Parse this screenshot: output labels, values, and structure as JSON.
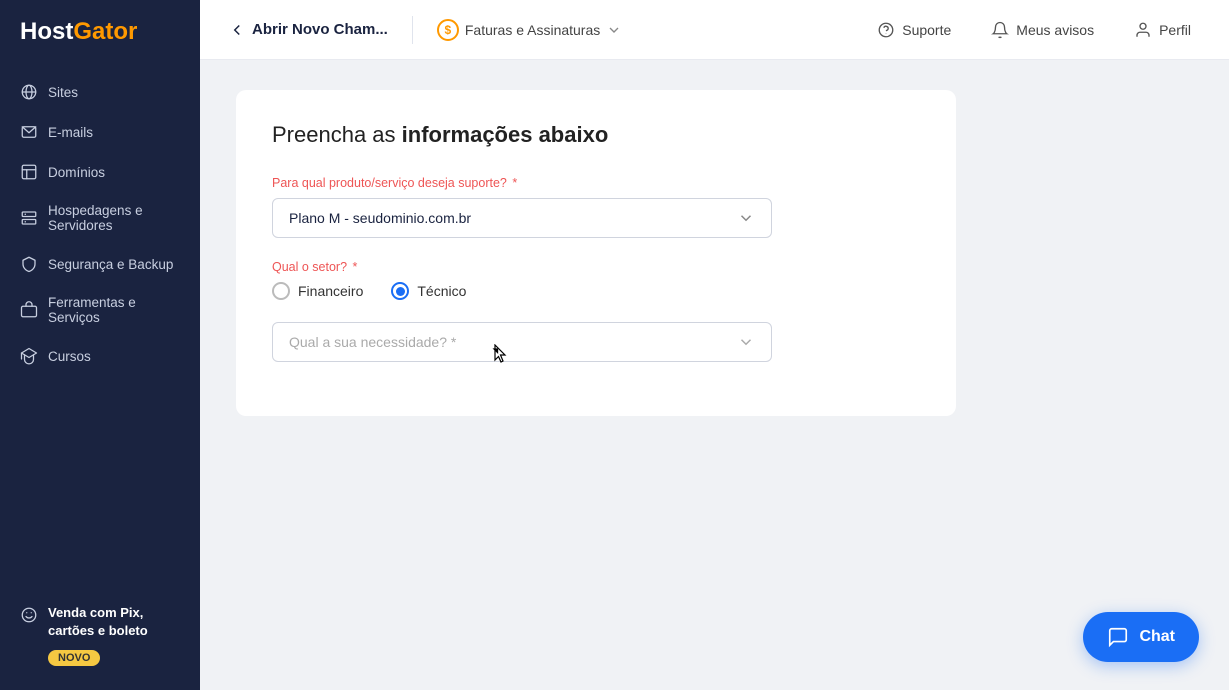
{
  "sidebar": {
    "logo": "HostGator",
    "items": [
      {
        "id": "sites",
        "label": "Sites"
      },
      {
        "id": "emails",
        "label": "E-mails"
      },
      {
        "id": "dominios",
        "label": "Domínios"
      },
      {
        "id": "hospedagens",
        "label": "Hospedagens e Servidores"
      },
      {
        "id": "seguranca",
        "label": "Segurança e Backup"
      },
      {
        "id": "ferramentas",
        "label": "Ferramentas e Serviços"
      },
      {
        "id": "cursos",
        "label": "Cursos"
      }
    ],
    "promo": {
      "title": "Venda com Pix, cartões e boleto",
      "badge": "NOVO"
    }
  },
  "topnav": {
    "back_label": "Abrir Novo Cham...",
    "menu_label": "Faturas e Assinaturas",
    "support_label": "Suporte",
    "notices_label": "Meus avisos",
    "profile_label": "Perfil"
  },
  "form": {
    "title_prefix": "Preencha as ",
    "title_highlight": "informações abaixo",
    "product_label": "Para qual produto/serviço deseja suporte?",
    "product_required": "*",
    "product_value": "Plano M - seudominio.com.br",
    "sector_label": "Qual o setor?",
    "sector_required": "*",
    "sector_options": [
      {
        "id": "financeiro",
        "label": "Financeiro",
        "selected": false
      },
      {
        "id": "tecnico",
        "label": "Técnico",
        "selected": true
      }
    ],
    "need_label": "Qual a sua necessidade?",
    "need_required": "*",
    "need_placeholder": "Qual a sua necessidade? *"
  },
  "chat": {
    "label": "Chat"
  }
}
